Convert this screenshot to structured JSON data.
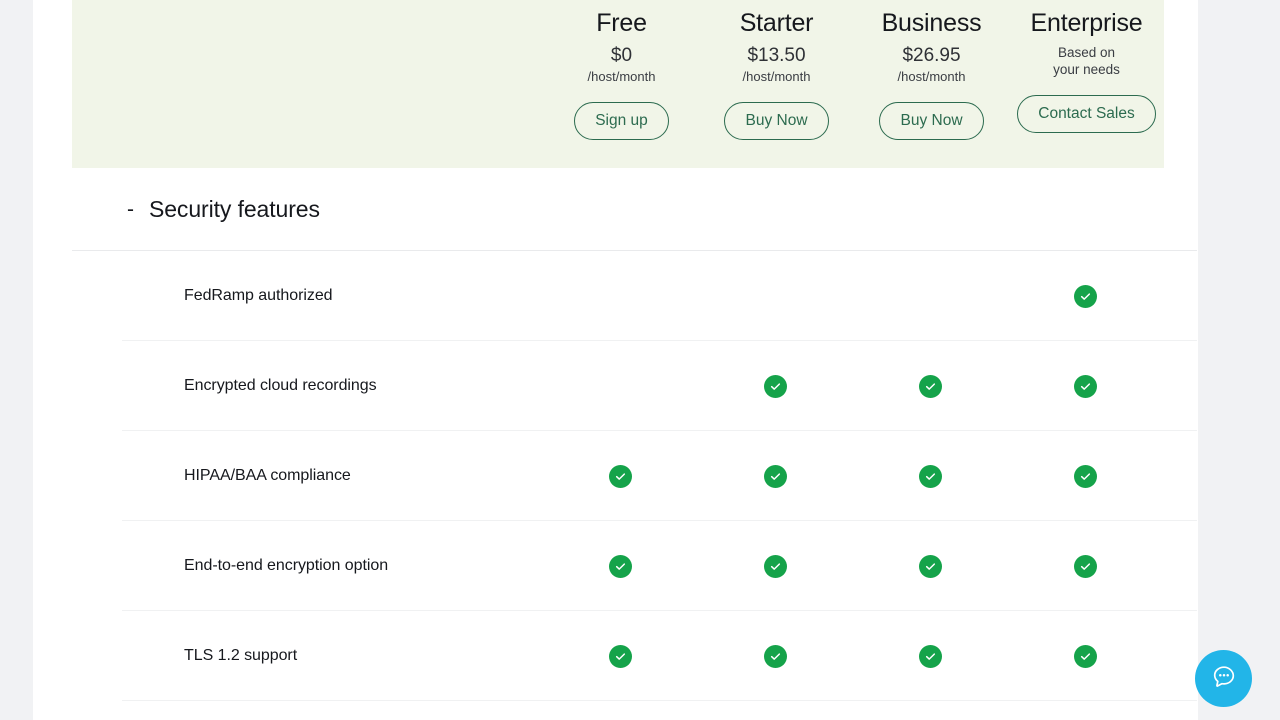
{
  "theme": {
    "page_background": "#f1f2f4",
    "content_background": "#ffffff",
    "header_panel_background": "#f1f5e8",
    "accent_green": "#2c6b4f",
    "check_green": "#15a34a",
    "chat_blue": "#22b5e8",
    "divider": "#f0f1f2"
  },
  "pricing_header": {
    "plans": [
      {
        "name": "Free",
        "price": "$0",
        "price_note": "/host/month",
        "price_stacked": false,
        "cta_label": "Sign up"
      },
      {
        "name": "Starter",
        "price": "$13.50",
        "price_note": "/host/month",
        "price_stacked": false,
        "cta_label": "Buy Now"
      },
      {
        "name": "Business",
        "price": "$26.95",
        "price_note": "/host/month",
        "price_stacked": false,
        "cta_label": "Buy Now"
      },
      {
        "name": "Enterprise",
        "price": "Based on",
        "price_note": "your needs",
        "price_stacked": true,
        "cta_label": "Contact Sales"
      }
    ]
  },
  "section": {
    "toggle_icon": "-",
    "toggle_state": "expanded",
    "title": "Security features"
  },
  "feature_table": {
    "columns": [
      "Free",
      "Starter",
      "Business",
      "Enterprise"
    ],
    "rows": [
      {
        "label": "FedRamp authorized",
        "values": [
          false,
          false,
          false,
          true
        ]
      },
      {
        "label": "Encrypted cloud recordings",
        "values": [
          false,
          true,
          true,
          true
        ]
      },
      {
        "label": "HIPAA/BAA compliance",
        "values": [
          true,
          true,
          true,
          true
        ]
      },
      {
        "label": "End-to-end encryption option",
        "values": [
          true,
          true,
          true,
          true
        ]
      },
      {
        "label": "TLS 1.2 support",
        "values": [
          true,
          true,
          true,
          true
        ]
      }
    ]
  },
  "chat_widget": {
    "icon": "chat-bubble-icon",
    "label": "Open chat"
  }
}
